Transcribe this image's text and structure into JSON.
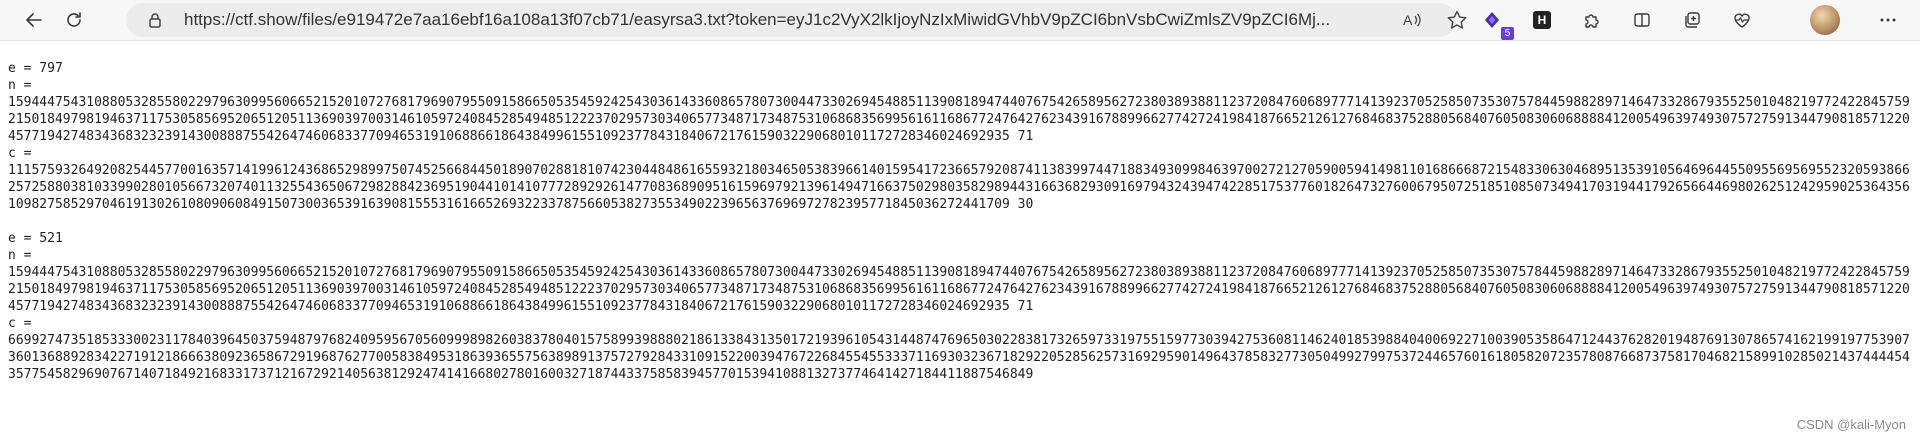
{
  "browser": {
    "url": "https://ctf.show/files/e919472e7aa16ebf16a108a13f07cb71/easyrsa3.txt?token=eyJ1c2VyX2lkIjoyNzIxMiwidGVhbV9pZCI6bnVsbCwiZmlsZV9pZCI6Mj...",
    "extension_badge": "5",
    "icons": [
      "back-icon",
      "refresh-icon",
      "lock-icon",
      "read-aloud-icon",
      "favorite-star-icon",
      "extension-icon",
      "h-extension-icon",
      "puzzle-icon",
      "split-screen-icon",
      "collections-icon",
      "heart-pulse-icon",
      "profile-avatar",
      "more-icon"
    ]
  },
  "blocks": [
    {
      "e_line": "e = 797",
      "n_label": "n =",
      "n_value": "15944475431088053285580229796309956066521520107276817969079550915866505354592425430361433608657807300447330269454885113908189474407675426589562723803893881123720847606897771413923705258507353075784459882897146473328679355250104821977242284575921501849798194637117530585695206512051136903970031461059724084528549485122237029573034065773487173487531068683569956161168677247642762343916788996627742724198418766521261276846837528805684076050830606888841200549639749307572759134479081857122045771942748343683232391430088875542647460683377094653191068866186438499615510923778431840672176159032290680101172728346024692935 71",
      "c_label": "c =",
      "c_value": "11157593264920825445770016357141996124368652989975074525668445018907028818107423044848616559321803465053839661401595417236657920874113839974471883493099846397002721270590059414981101686668721548330630468951353910564696445509556956955232059386625725880381033990280105667320740113255436506729828842369519044101410777289292614770836890951615969792139614947166375029803582989443166368293091697943243947422851753776018264732760067950725185108507349417031944179265664469802625124295902536435610982758529704619130261080906084915073003653916390815553161665269322337875660538273553490223965637696972782395771845036272441709 30"
    },
    {
      "e_line": "e = 521",
      "n_label": "n =",
      "n_value": "15944475431088053285580229796309956066521520107276817969079550915866505354592425430361433608657807300447330269454885113908189474407675426589562723803893881123720847606897771413923705258507353075784459882897146473328679355250104821977242284575921501849798194637117530585695206512051136903970031461059724084528549485122237029573034065773487173487531068683569956161168677247642762343916788996627742724198418766521261276846837528805684076050830606888841200549639749307572759134479081857122045771942748343683232391430088875542647460683377094653191068866186438499615510923778431840672176159032290680101172728346024692935 71",
      "c_label": "c =",
      "c_value": "66992747351853330023117840396450375948797682409595670560999898260383780401575899398880218613384313501721939610543144874769650302283817326597331975515977303942753608114624018539884040069227100390535864712443762820194876913078657416219919775390736013688928342271912186663809236586729196876277005838495318639365575638989137572792843310915220039476722684554553337116930323671829220528562573169295901496437858327730504992799753724465760161805820723578087668737581704682158991028502143744445435775458296907671407184921683317371216729214056381292474141668027801600327187443375858394577015394108813273774641427184411887546849"
    }
  ],
  "watermark": "CSDN @kali-Myon"
}
